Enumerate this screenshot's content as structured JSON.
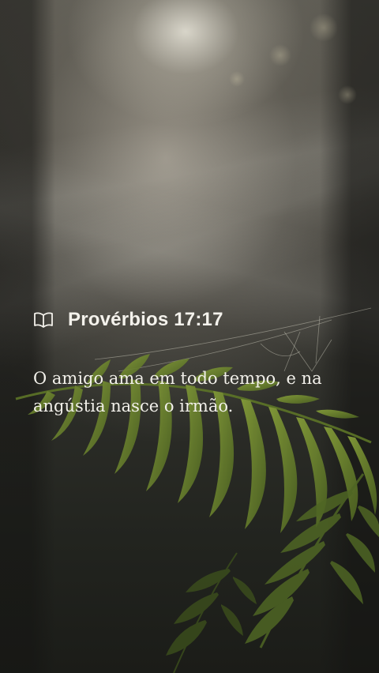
{
  "verse_card": {
    "reference": "Provérbios 17:17",
    "text": "O amigo ama em todo tempo, e na angústia nasce o irmão.",
    "icon": "book-open-icon"
  },
  "colors": {
    "text": "#f2f0ea",
    "fern": "#6f8a2e"
  }
}
